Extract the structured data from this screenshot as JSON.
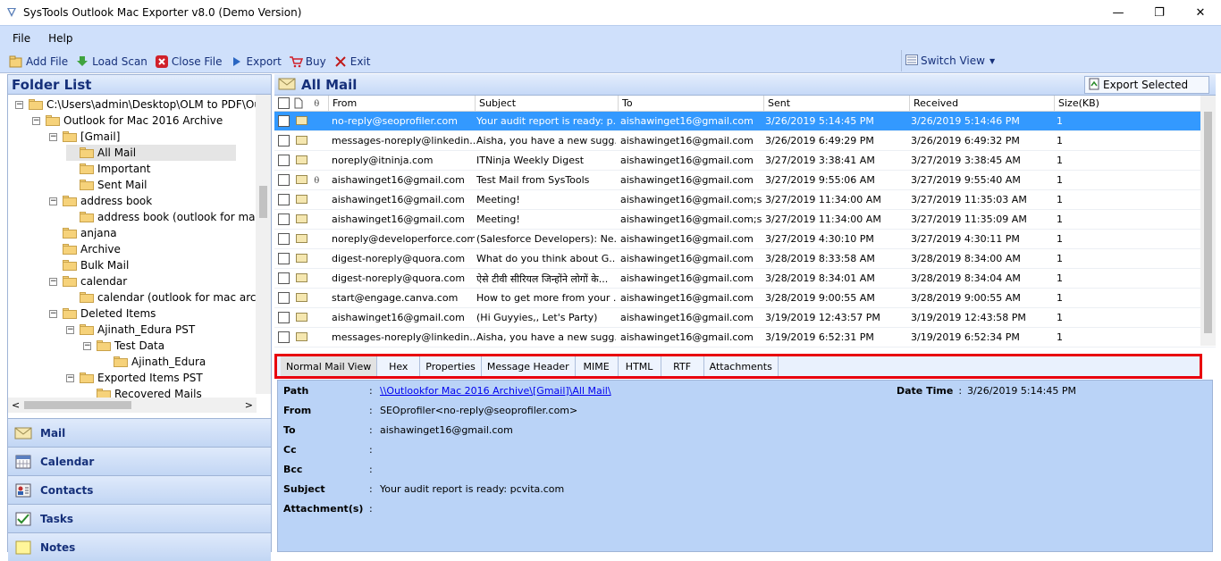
{
  "window": {
    "title": "SysTools Outlook Mac Exporter v8.0 (Demo Version)",
    "controls": {
      "minimize": "—",
      "maximize": "❐",
      "close": "✕"
    }
  },
  "menu": [
    "File",
    "Help"
  ],
  "toolbar": {
    "add_file": "Add File",
    "load_scan": "Load Scan",
    "close_file": "Close File",
    "export": "Export",
    "buy": "Buy",
    "exit": "Exit",
    "switch_view": "Switch View"
  },
  "folder_list": {
    "title": "Folder List",
    "tree": [
      {
        "label": "C:\\Users\\admin\\Desktop\\OLM to PDF\\Outlc",
        "level": 0,
        "expander": "−"
      },
      {
        "label": "Outlook for Mac 2016 Archive",
        "level": 1,
        "expander": "−"
      },
      {
        "label": "[Gmail]",
        "level": 2,
        "expander": "−"
      },
      {
        "label": "All Mail",
        "level": 3,
        "selected": true
      },
      {
        "label": "Important",
        "level": 3
      },
      {
        "label": "Sent Mail",
        "level": 3
      },
      {
        "label": "address book",
        "level": 2,
        "expander": "−"
      },
      {
        "label": "address book (outlook for mac ar",
        "level": 3
      },
      {
        "label": "anjana",
        "level": 2
      },
      {
        "label": "Archive",
        "level": 2
      },
      {
        "label": "Bulk Mail",
        "level": 2
      },
      {
        "label": "calendar",
        "level": 2,
        "expander": "−"
      },
      {
        "label": "calendar (outlook for mac archive",
        "level": 3
      },
      {
        "label": "Deleted Items",
        "level": 2,
        "expander": "−"
      },
      {
        "label": "Ajinath_Edura PST",
        "level": 3,
        "expander": "−"
      },
      {
        "label": "Test Data",
        "level": 4,
        "expander": "−"
      },
      {
        "label": "Ajinath_Edura",
        "level": 5
      },
      {
        "label": "Exported Items PST",
        "level": 3,
        "expander": "−"
      },
      {
        "label": "Recovered Mails",
        "level": 4
      }
    ]
  },
  "nav": [
    "Mail",
    "Calendar",
    "Contacts",
    "Tasks",
    "Notes"
  ],
  "mail_list": {
    "title": "All Mail",
    "export_selected": "Export Selected",
    "columns": {
      "from": "From",
      "subject": "Subject",
      "to": "To",
      "sent": "Sent",
      "received": "Received",
      "size": "Size(KB)"
    },
    "rows": [
      {
        "from": "no-reply@seoprofiler.com",
        "subject": "Your audit report is ready: p...",
        "to": "aishawinget16@gmail.com",
        "sent": "3/26/2019 5:14:45 PM",
        "received": "3/26/2019 5:14:46 PM",
        "size": "1",
        "selected": true
      },
      {
        "from": "messages-noreply@linkedin...",
        "subject": "Aisha, you have a new sugg...",
        "to": "aishawinget16@gmail.com",
        "sent": "3/26/2019 6:49:29 PM",
        "received": "3/26/2019 6:49:32 PM",
        "size": "1"
      },
      {
        "from": "noreply@itninja.com",
        "subject": "ITNinja Weekly Digest",
        "to": "aishawinget16@gmail.com",
        "sent": "3/27/2019 3:38:41 AM",
        "received": "3/27/2019 3:38:45 AM",
        "size": "1"
      },
      {
        "from": "aishawinget16@gmail.com",
        "subject": "Test Mail from SysTools",
        "to": "aishawinget16@gmail.com",
        "sent": "3/27/2019 9:55:06 AM",
        "received": "3/27/2019 9:55:40 AM",
        "size": "1",
        "attachment": true
      },
      {
        "from": "aishawinget16@gmail.com",
        "subject": "Meeting!",
        "to": "aishawinget16@gmail.com;s...",
        "sent": "3/27/2019 11:34:00 AM",
        "received": "3/27/2019 11:35:03 AM",
        "size": "1"
      },
      {
        "from": "aishawinget16@gmail.com",
        "subject": "Meeting!",
        "to": "aishawinget16@gmail.com;s...",
        "sent": "3/27/2019 11:34:00 AM",
        "received": "3/27/2019 11:35:09 AM",
        "size": "1"
      },
      {
        "from": "noreply@developerforce.com",
        "subject": "(Salesforce Developers): Ne...",
        "to": "aishawinget16@gmail.com",
        "sent": "3/27/2019 4:30:10 PM",
        "received": "3/27/2019 4:30:11 PM",
        "size": "1"
      },
      {
        "from": "digest-noreply@quora.com",
        "subject": "What do you think about G...",
        "to": "aishawinget16@gmail.com",
        "sent": "3/28/2019 8:33:58 AM",
        "received": "3/28/2019 8:34:00 AM",
        "size": "1"
      },
      {
        "from": "digest-noreply@quora.com",
        "subject": "ऐसे टीवी सीरियल जिन्होंने लोगों के...",
        "to": "aishawinget16@gmail.com",
        "sent": "3/28/2019 8:34:01 AM",
        "received": "3/28/2019 8:34:04 AM",
        "size": "1"
      },
      {
        "from": "start@engage.canva.com",
        "subject": "How to get more from your ...",
        "to": "aishawinget16@gmail.com",
        "sent": "3/28/2019 9:00:55 AM",
        "received": "3/28/2019 9:00:55 AM",
        "size": "1"
      },
      {
        "from": "aishawinget16@gmail.com",
        "subject": "(Hi Guyyies,, Let's Party)",
        "to": "aishawinget16@gmail.com",
        "sent": "3/19/2019 12:43:57 PM",
        "received": "3/19/2019 12:43:58 PM",
        "size": "1"
      },
      {
        "from": "messages-noreply@linkedin...",
        "subject": "Aisha, you have a new sugg...",
        "to": "aishawinget16@gmail.com",
        "sent": "3/19/2019 6:52:31 PM",
        "received": "3/19/2019 6:52:34 PM",
        "size": "1"
      }
    ]
  },
  "view_tabs": [
    "Normal Mail View",
    "Hex",
    "Properties",
    "Message Header",
    "MIME",
    "HTML",
    "RTF",
    "Attachments"
  ],
  "detail": {
    "path_label": "Path",
    "path_link": "\\\\Outlook",
    "path_rest": " for Mac 2016 Archive\\[Gmail]\\All Mail\\",
    "date_label": "Date Time",
    "date_value": "3/26/2019 5:14:45 PM",
    "from_label": "From",
    "from_value": "SEOprofiler<no-reply@seoprofiler.com>",
    "to_label": "To",
    "to_value": "aishawinget16@gmail.com",
    "cc_label": "Cc",
    "bcc_label": "Bcc",
    "subject_label": "Subject",
    "subject_value": "Your audit report is ready: pcvita.com",
    "attachments_label": "Attachment(s)",
    "sep": ":"
  },
  "colors": {
    "accent": "#3399ff",
    "highlight_border": "#e8000d",
    "panel": "#bad3f7",
    "header_text": "#16307a"
  }
}
